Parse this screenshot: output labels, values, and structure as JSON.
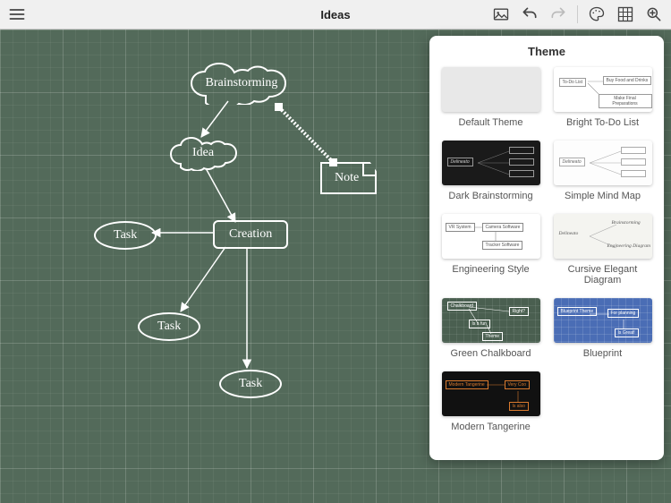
{
  "toolbar": {
    "title": "Ideas",
    "menu_icon": "menu",
    "image_icon": "image",
    "undo_icon": "undo",
    "redo_icon": "redo",
    "theme_icon": "palette",
    "grid_icon": "grid",
    "zoom_icon": "zoom"
  },
  "canvas": {
    "theme": "Green Chalkboard",
    "nodes": {
      "brainstorming": "Brainstorming",
      "idea": "Idea",
      "note": "Note",
      "creation": "Creation",
      "task1": "Task",
      "task2": "Task",
      "task3": "Task"
    }
  },
  "theme_panel": {
    "title": "Theme",
    "items": [
      {
        "label": "Default Theme",
        "key": "default"
      },
      {
        "label": "Bright To-Do List",
        "key": "bright"
      },
      {
        "label": "Dark Brainstorming",
        "key": "dark"
      },
      {
        "label": "Simple Mind Map",
        "key": "simple"
      },
      {
        "label": "Engineering Style",
        "key": "engineering"
      },
      {
        "label": "Cursive Elegant Diagram",
        "key": "cursive"
      },
      {
        "label": "Green Chalkboard",
        "key": "green"
      },
      {
        "label": "Blueprint",
        "key": "blueprint"
      },
      {
        "label": "Modern Tangerine",
        "key": "tangerine"
      }
    ],
    "thumbs": {
      "bright": {
        "a": "To-Do List",
        "b": "Buy Food and Drinks",
        "c": "Make Final Preparations"
      },
      "dark": {
        "a": "Delineato"
      },
      "simple": {
        "a": "Delineato"
      },
      "eng": {
        "a": "VR System",
        "b": "Camera Software",
        "c": "Tracker Software"
      },
      "cursive": {
        "a": "Delineato",
        "b": "Brainstorming",
        "c": "Engineering Diagram"
      },
      "green": {
        "a": "Chalkboard",
        "b": "Right?",
        "c": "Is a fun",
        "d": "Theme"
      },
      "blue": {
        "a": "Blueprint Theme",
        "b": "For planning",
        "c": "Is Great!"
      },
      "tangerine": {
        "a": "Modern Tangerine",
        "b": "Very Coo",
        "c": "Is also"
      }
    }
  }
}
